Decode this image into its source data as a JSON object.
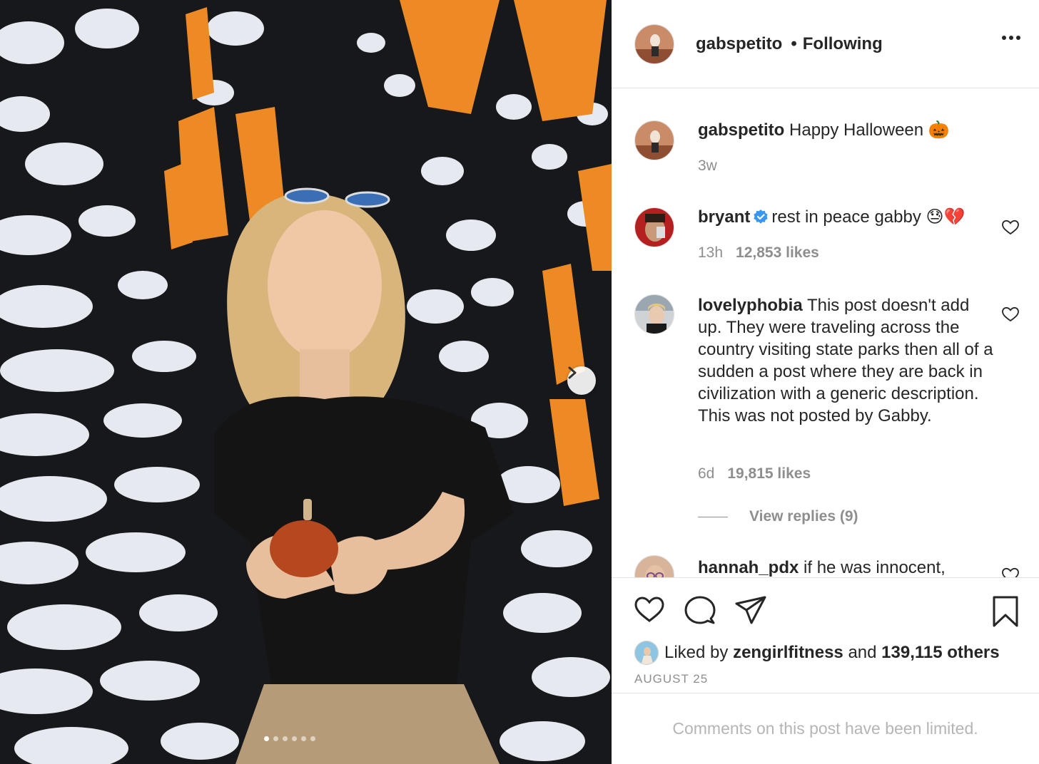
{
  "post": {
    "username": "gabspetito",
    "separator": "•",
    "follow_status": "Following",
    "more_icon": "more-horizontal-icon"
  },
  "caption": {
    "username": "gabspetito",
    "text": "Happy Halloween 🎃",
    "time": "3w"
  },
  "comments": [
    {
      "username": "bryant",
      "verified": true,
      "text": "rest in peace gabby 😓💔",
      "time": "13h",
      "likes": "12,853 likes"
    },
    {
      "username": "lovelyphobia",
      "verified": false,
      "text": "This post doesn't add up. They were traveling across the country visiting state parks then all of a sudden a post where they are back in civilization with a generic description. This was not posted by Gabby.",
      "time": "6d",
      "likes": "19,815 likes",
      "view_replies": "View replies (9)"
    },
    {
      "username": "hannah_pdx",
      "verified": false,
      "text": "if he was innocent,"
    }
  ],
  "actions": {
    "like_icon": "heart-icon",
    "comment_icon": "comment-icon",
    "share_icon": "paper-plane-icon",
    "save_icon": "bookmark-icon"
  },
  "liked_by": {
    "prefix": "Liked by",
    "user": "zengirlfitness",
    "and": "and",
    "others": "139,115 others"
  },
  "date": "AUGUST 25",
  "footer_note": "Comments on this post have been limited.",
  "carousel": {
    "total": 6,
    "active_index": 0
  },
  "colors": {
    "text": "#262626",
    "secondary": "#8e8e8e",
    "divider": "#e3e3e3",
    "verified_blue": "#3897f0"
  }
}
